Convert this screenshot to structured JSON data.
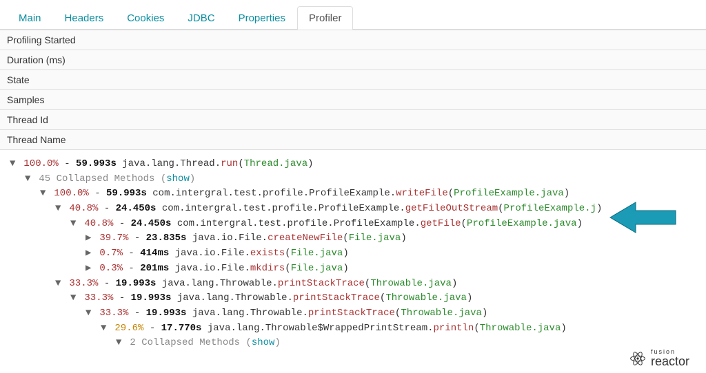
{
  "tabs": [
    {
      "label": "Main"
    },
    {
      "label": "Headers"
    },
    {
      "label": "Cookies"
    },
    {
      "label": "JDBC"
    },
    {
      "label": "Properties"
    },
    {
      "label": "Profiler",
      "active": true
    }
  ],
  "meta": [
    {
      "label": "Profiling Started"
    },
    {
      "label": "Duration (ms)"
    },
    {
      "label": "State"
    },
    {
      "label": "Samples"
    },
    {
      "label": "Thread Id"
    },
    {
      "label": "Thread Name"
    }
  ],
  "tree": {
    "pct": "100.0%",
    "time": "59.993s",
    "pkg": "java.lang.Thread.",
    "method": "run",
    "file": "Thread.java",
    "tri": "▼",
    "children": [
      {
        "collapsed": true,
        "count": "45",
        "tri": "▼",
        "children": [
          {
            "pct": "100.0%",
            "time": "59.993s",
            "pkg": "com.intergral.test.profile.ProfileExample.",
            "method": "writeFile",
            "file": "ProfileExample.java",
            "tri": "▼",
            "children": [
              {
                "pct": "40.8%",
                "time": "24.450s",
                "pkg": "com.intergral.test.profile.ProfileExample.",
                "method": "getFileOutStream",
                "file": "ProfileExample.j",
                "tri": "▼",
                "children": [
                  {
                    "pct": "40.8%",
                    "time": "24.450s",
                    "pkg": "com.intergral.test.profile.ProfileExample.",
                    "method": "getFile",
                    "file": "ProfileExample.java",
                    "tri": "▼",
                    "children": [
                      {
                        "pct": "39.7%",
                        "time": "23.835s",
                        "pkg": "java.io.File.",
                        "method": "createNewFile",
                        "file": "File.java",
                        "tri": "▶"
                      },
                      {
                        "pct": "0.7%",
                        "time": "414ms",
                        "pkg": "java.io.File.",
                        "method": "exists",
                        "file": "File.java",
                        "tri": "▶"
                      },
                      {
                        "pct": "0.3%",
                        "time": "201ms",
                        "pkg": "java.io.File.",
                        "method": "mkdirs",
                        "file": "File.java",
                        "tri": "▶"
                      }
                    ]
                  }
                ]
              },
              {
                "pct": "33.3%",
                "time": "19.993s",
                "pkg": "java.lang.Throwable.",
                "method": "printStackTrace",
                "file": "Throwable.java",
                "tri": "▼",
                "children": [
                  {
                    "pct": "33.3%",
                    "time": "19.993s",
                    "pkg": "java.lang.Throwable.",
                    "method": "printStackTrace",
                    "file": "Throwable.java",
                    "tri": "▼",
                    "children": [
                      {
                        "pct": "33.3%",
                        "time": "19.993s",
                        "pkg": "java.lang.Throwable.",
                        "method": "printStackTrace",
                        "file": "Throwable.java",
                        "tri": "▼",
                        "children": [
                          {
                            "pct": "29.6%",
                            "pctcolor": "orange",
                            "time": "17.770s",
                            "pkg": "java.lang.Throwable$WrappedPrintStream.",
                            "method": "println",
                            "file": "Throwable.java",
                            "tri": "▼",
                            "children": [
                              {
                                "collapsed": true,
                                "count": "2",
                                "tri": "▼"
                              }
                            ]
                          }
                        ]
                      }
                    ]
                  }
                ]
              }
            ]
          }
        ]
      }
    ]
  },
  "strings": {
    "sep": " - ",
    "collapsed_prefix": " Collapsed Methods ",
    "show": "show",
    "logo_small": "fusion",
    "logo_big": "reactor"
  },
  "colors": {
    "link": "#0a8ea0",
    "pct_red": "#a33",
    "pct_orange": "#c88400",
    "file_green": "#2a8a2a",
    "arrow": "#1b9bb5"
  }
}
